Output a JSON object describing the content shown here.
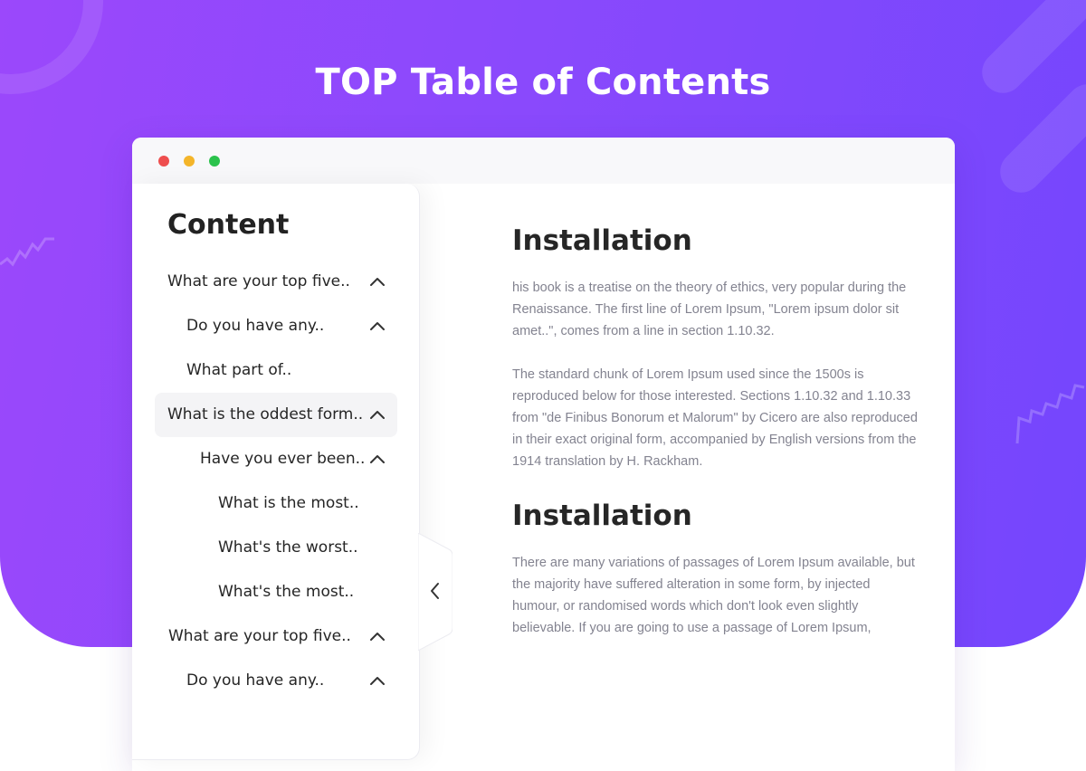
{
  "page": {
    "title": "TOP Table of Contents",
    "accent_colors": {
      "gradient_start": "#9b48fb",
      "gradient_end": "#7446fd"
    }
  },
  "window": {
    "controls": [
      "close",
      "minimize",
      "maximize"
    ],
    "control_colors": {
      "close": "#ee4e4e",
      "minimize": "#f4b52a",
      "maximize": "#2bc24c"
    }
  },
  "toc": {
    "heading": "Content",
    "items": [
      {
        "label": "What are your top five..",
        "level": 1,
        "expanded": true,
        "has_toggle": true
      },
      {
        "label": "Do you have any..",
        "level": 2,
        "expanded": true,
        "has_toggle": true
      },
      {
        "label": "What part of..",
        "level": 2,
        "has_toggle": false
      },
      {
        "label": "What is the oddest form..",
        "level": 1,
        "expanded": true,
        "has_toggle": true,
        "active": true
      },
      {
        "label": "Have you ever been..",
        "level": 2,
        "expanded": true,
        "has_toggle": true
      },
      {
        "label": "What is the most..",
        "level": 3,
        "has_toggle": false
      },
      {
        "label": "What's the worst..",
        "level": 3,
        "has_toggle": false
      },
      {
        "label": "What's the most..",
        "level": 3,
        "has_toggle": false
      },
      {
        "label": "What are your top five..",
        "level": 1,
        "expanded": true,
        "has_toggle": true
      },
      {
        "label": "Do you have any..",
        "level": 2,
        "expanded": true,
        "has_toggle": true
      }
    ],
    "toggle_icon": "chevron-up-icon",
    "collapse_icon": "chevron-left-icon"
  },
  "content": {
    "sections": [
      {
        "title": "Installation",
        "paragraphs": [
          "his book is a treatise on the theory of ethics, very popular during the Renaissance. The first line of Lorem Ipsum, \"Lorem ipsum dolor sit amet..\", comes from a line in section 1.10.32.",
          "The standard chunk of Lorem Ipsum used since the 1500s is reproduced below for those interested. Sections 1.10.32 and 1.10.33 from \"de Finibus Bonorum et Malorum\" by Cicero are also reproduced in their exact original form, accompanied by English versions from the 1914 translation by H. Rackham."
        ]
      },
      {
        "title": "Installation",
        "paragraphs": [
          "There are many variations of passages of Lorem Ipsum available, but the majority have suffered alteration in some form, by injected humour, or randomised words which don't look even slightly believable. If you are going to use a passage of Lorem Ipsum,"
        ]
      }
    ]
  }
}
